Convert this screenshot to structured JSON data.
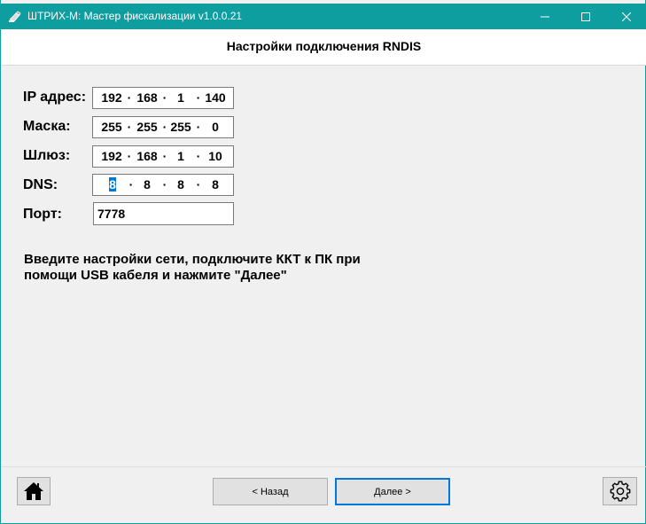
{
  "window": {
    "title": "ШТРИХ-М: Мастер фискализации v1.0.0.21",
    "accent_color": "#0f9ea0",
    "icons": [
      "app-icon",
      "minimize-icon",
      "maximize-icon",
      "close-icon"
    ]
  },
  "header": {
    "title": "Настройки подключения RNDIS"
  },
  "form": {
    "ip": {
      "label": "IP адрес:",
      "octets": [
        "192",
        "168",
        "1",
        "140"
      ]
    },
    "mask": {
      "label": "Маска:",
      "octets": [
        "255",
        "255",
        "255",
        "0"
      ]
    },
    "gateway": {
      "label": "Шлюз:",
      "octets": [
        "192",
        "168",
        "1",
        "10"
      ]
    },
    "dns": {
      "label": "DNS:",
      "octets": [
        "8",
        "8",
        "8",
        "8"
      ]
    },
    "port": {
      "label": "Порт:",
      "value": "7778"
    }
  },
  "instruction": {
    "line1": "Введите настройки сети, подключите ККТ к ПК при",
    "line2": "помощи USB кабеля и нажмите \"Далее\""
  },
  "footer": {
    "back_label": "< Назад",
    "next_label": "Далее >",
    "home_icon": "home-icon",
    "settings_icon": "gear-icon"
  }
}
